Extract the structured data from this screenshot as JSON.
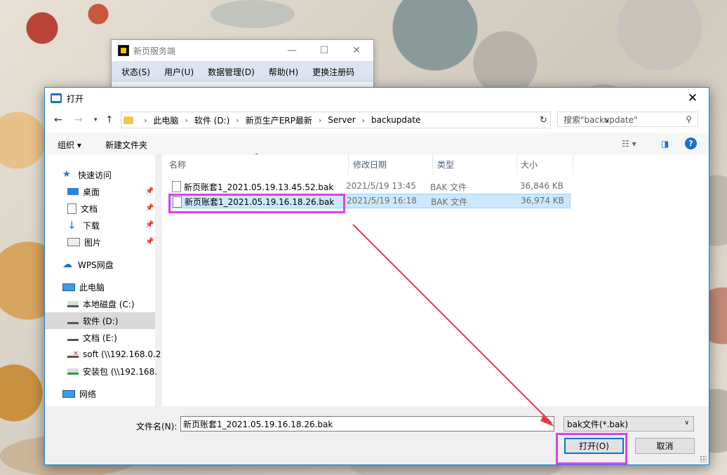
{
  "bg_window": {
    "title": "新页服务端",
    "menu": [
      "状态(S)",
      "用户(U)",
      "数据管理(D)",
      "帮助(H)",
      "更换注册码"
    ]
  },
  "dialog": {
    "title": "打开",
    "breadcrumb": [
      "此电脑",
      "软件 (D:)",
      "新页生产ERP最新",
      "Server",
      "backupdate"
    ],
    "search_placeholder": "搜索\"backupdate\"",
    "toolbar": {
      "organize": "组织 ▾",
      "new_folder": "新建文件夹"
    },
    "nav": [
      {
        "label": "快速访问",
        "icon": "star-icon",
        "pinned": false
      },
      {
        "label": "桌面",
        "icon": "desktop-icon",
        "pinned": true
      },
      {
        "label": "文档",
        "icon": "document-icon",
        "pinned": true
      },
      {
        "label": "下载",
        "icon": "download-icon",
        "pinned": true
      },
      {
        "label": "图片",
        "icon": "pictures-icon",
        "pinned": true
      },
      {
        "label": "WPS网盘",
        "icon": "cloud-icon",
        "pinned": false
      },
      {
        "label": "此电脑",
        "icon": "computer-icon",
        "pinned": false
      },
      {
        "label": "本地磁盘 (C:)",
        "icon": "drive-icon",
        "pinned": false
      },
      {
        "label": "软件 (D:)",
        "icon": "drive-icon",
        "pinned": false,
        "selected": true
      },
      {
        "label": "文档 (E:)",
        "icon": "drive-icon",
        "pinned": false
      },
      {
        "label": "soft (\\\\192.168.0.2",
        "icon": "network-drive-icon",
        "pinned": false
      },
      {
        "label": "安装包 (\\\\192.168.",
        "icon": "network-drive-icon",
        "pinned": false
      },
      {
        "label": "网络",
        "icon": "network-icon",
        "pinned": false
      }
    ],
    "columns": {
      "name": "名称",
      "date": "修改日期",
      "type": "类型",
      "size": "大小"
    },
    "files": [
      {
        "name": "新页账套1_2021.05.19.13.45.52.bak",
        "date": "2021/5/19 13:45",
        "type": "BAK 文件",
        "size": "36,846 KB"
      },
      {
        "name": "新页账套1_2021.05.19.16.18.26.bak",
        "date": "2021/5/19 16:18",
        "type": "BAK 文件",
        "size": "36,974 KB",
        "selected": true
      }
    ],
    "filename_label": "文件名(N):",
    "filename_value": "新页账套1_2021.05.19.16.18.26.bak",
    "filter": "bak文件(*.bak)",
    "open_button": "打开(O)",
    "cancel_button": "取消"
  },
  "colors": {
    "annotation": "#e040e8",
    "arrow": "#ee3344",
    "accent": "#0078d7"
  }
}
